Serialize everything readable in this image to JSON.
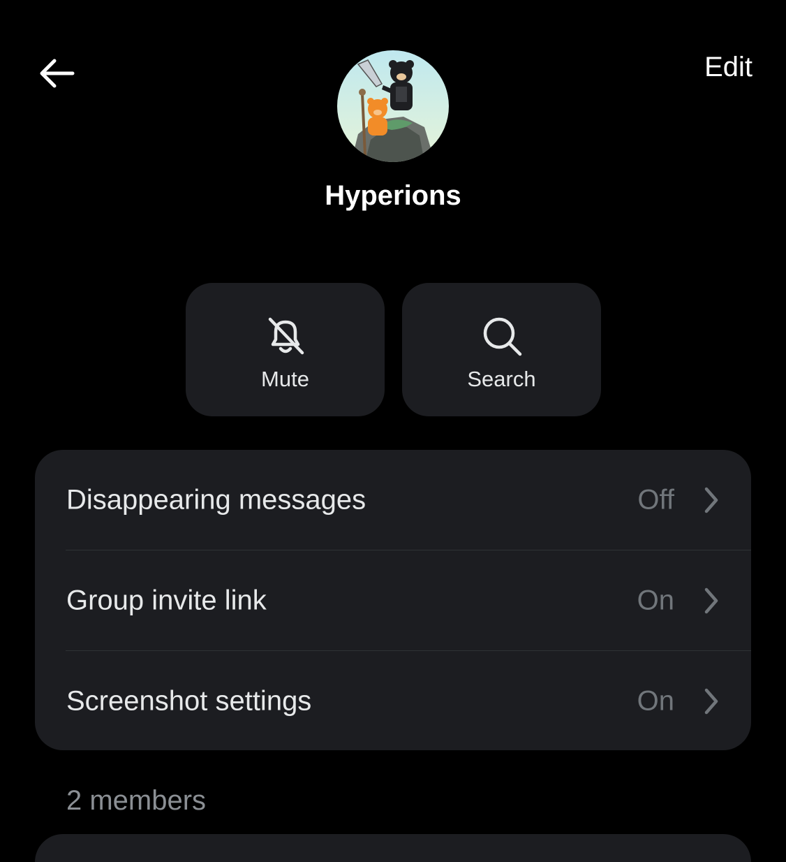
{
  "header": {
    "back_icon": "arrow-left-icon",
    "edit_label": "Edit"
  },
  "group": {
    "name": "Hyperions",
    "avatar_icon": "group-avatar-bears"
  },
  "actions": [
    {
      "label": "Mute",
      "icon": "bell-off-icon"
    },
    {
      "label": "Search",
      "icon": "search-icon"
    }
  ],
  "settings": [
    {
      "label": "Disappearing messages",
      "value": "Off"
    },
    {
      "label": "Group invite link",
      "value": "On"
    },
    {
      "label": "Screenshot settings",
      "value": "On"
    }
  ],
  "members": {
    "heading": "2 members"
  },
  "colors": {
    "background": "#000000",
    "card": "#1c1d21",
    "primary_text": "#e7e9ea",
    "secondary_text": "#71767b"
  }
}
